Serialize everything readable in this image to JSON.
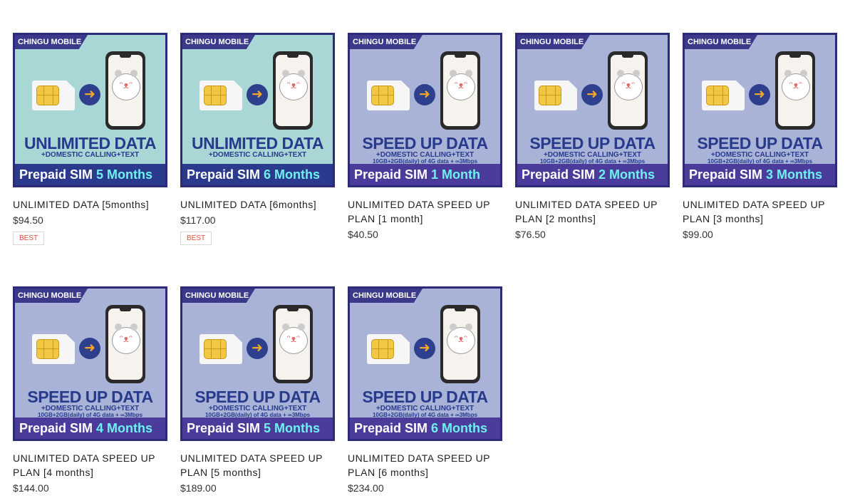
{
  "products": [
    {
      "tag": "CHINGU MOBILE",
      "headline": "UNLIMITED DATA",
      "subline": "+DOMESTIC CALLING+TEXT",
      "detail": "",
      "banner_prefix": "Prepaid SIM",
      "banner_duration": "5 Months",
      "title": "UNLIMITED DATA [5months]",
      "price": "$94.50",
      "badge": "BEST",
      "theme": "teal"
    },
    {
      "tag": "CHINGU MOBILE",
      "headline": "UNLIMITED DATA",
      "subline": "+DOMESTIC CALLING+TEXT",
      "detail": "",
      "banner_prefix": "Prepaid SIM",
      "banner_duration": "6 Months",
      "title": "UNLIMITED DATA [6months]",
      "price": "$117.00",
      "badge": "BEST",
      "theme": "teal"
    },
    {
      "tag": "CHINGU MOBILE",
      "headline": "SPEED UP DATA",
      "subline": "+DOMESTIC CALLING+TEXT",
      "detail": "10GB+2GB(daily) of 4G data + ∞3Mbps",
      "banner_prefix": "Prepaid SIM",
      "banner_duration": "1 Month",
      "title": "UNLIMITED DATA SPEED UP PLAN [1 month]",
      "price": "$40.50",
      "badge": "",
      "theme": "lav"
    },
    {
      "tag": "CHINGU MOBILE",
      "headline": "SPEED UP DATA",
      "subline": "+DOMESTIC CALLING+TEXT",
      "detail": "10GB+2GB(daily) of 4G data + ∞3Mbps",
      "banner_prefix": "Prepaid SIM",
      "banner_duration": "2 Months",
      "title": "UNLIMITED DATA SPEED UP PLAN [2 months]",
      "price": "$76.50",
      "badge": "",
      "theme": "lav"
    },
    {
      "tag": "CHINGU MOBILE",
      "headline": "SPEED UP DATA",
      "subline": "+DOMESTIC CALLING+TEXT",
      "detail": "10GB+2GB(daily) of 4G data + ∞3Mbps",
      "banner_prefix": "Prepaid SIM",
      "banner_duration": "3 Months",
      "title": "UNLIMITED DATA SPEED UP PLAN [3 months]",
      "price": "$99.00",
      "badge": "",
      "theme": "lav"
    },
    {
      "tag": "CHINGU MOBILE",
      "headline": "SPEED UP DATA",
      "subline": "+DOMESTIC CALLING+TEXT",
      "detail": "10GB+2GB(daily) of 4G data + ∞3Mbps",
      "banner_prefix": "Prepaid SIM",
      "banner_duration": "4 Months",
      "title": "UNLIMITED DATA SPEED UP PLAN [4 months]",
      "price": "$144.00",
      "badge": "",
      "theme": "lav"
    },
    {
      "tag": "CHINGU MOBILE",
      "headline": "SPEED UP DATA",
      "subline": "+DOMESTIC CALLING+TEXT",
      "detail": "10GB+2GB(daily) of 4G data + ∞3Mbps",
      "banner_prefix": "Prepaid SIM",
      "banner_duration": "5 Months",
      "title": "UNLIMITED DATA SPEED UP PLAN [5 months]",
      "price": "$189.00",
      "badge": "",
      "theme": "lav"
    },
    {
      "tag": "CHINGU MOBILE",
      "headline": "SPEED UP DATA",
      "subline": "+DOMESTIC CALLING+TEXT",
      "detail": "10GB+2GB(daily) of 4G data + ∞3Mbps",
      "banner_prefix": "Prepaid SIM",
      "banner_duration": "6 Months",
      "title": "UNLIMITED DATA SPEED UP PLAN [6 months]",
      "price": "$234.00",
      "badge": "",
      "theme": "lav"
    }
  ]
}
